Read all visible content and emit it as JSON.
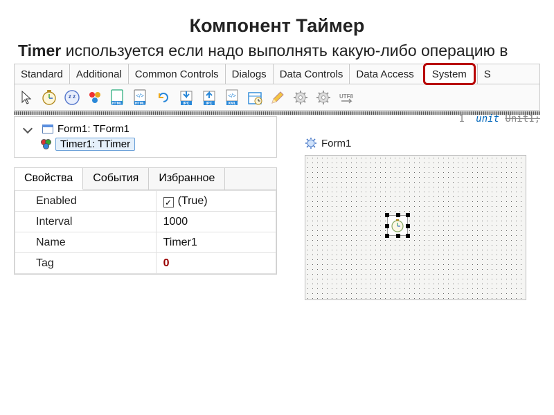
{
  "title": "Компонент Таймер",
  "subtitle_bold": "Timer",
  "subtitle_rest": " используется если надо выполнять какую-либо операцию в",
  "palette": {
    "tabs": [
      "Standard",
      "Additional",
      "Common Controls",
      "Dialogs",
      "Data Controls",
      "Data Access"
    ],
    "highlighted_tab": "System",
    "trail": "S"
  },
  "toolbar_icons": [
    "cursor-icon",
    "clock-icon",
    "idle-icon",
    "process-icon",
    "html-doc-icon",
    "html-code-icon",
    "refresh-icon",
    "ipc-in-icon",
    "ipc-out-icon",
    "xml-icon",
    "schedule-icon",
    "pencil-icon",
    "gear-icon",
    "gear-icon",
    "utf8-icon"
  ],
  "tree": {
    "root": "Form1: TForm1",
    "child": "Timer1: TTimer"
  },
  "inspector": {
    "tabs": [
      "Свойства",
      "События",
      "Избранное"
    ],
    "active_tab": 0,
    "rows": [
      {
        "name": "Enabled",
        "value": "(True)",
        "checkbox": true
      },
      {
        "name": "Interval",
        "value": "1000"
      },
      {
        "name": "Name",
        "value": "Timer1"
      },
      {
        "name": "Tag",
        "value": "0",
        "bold": true
      }
    ]
  },
  "code": {
    "line": "1",
    "kw": "unit",
    "ident": "Unit1;"
  },
  "designer": {
    "caption": "Form1"
  }
}
